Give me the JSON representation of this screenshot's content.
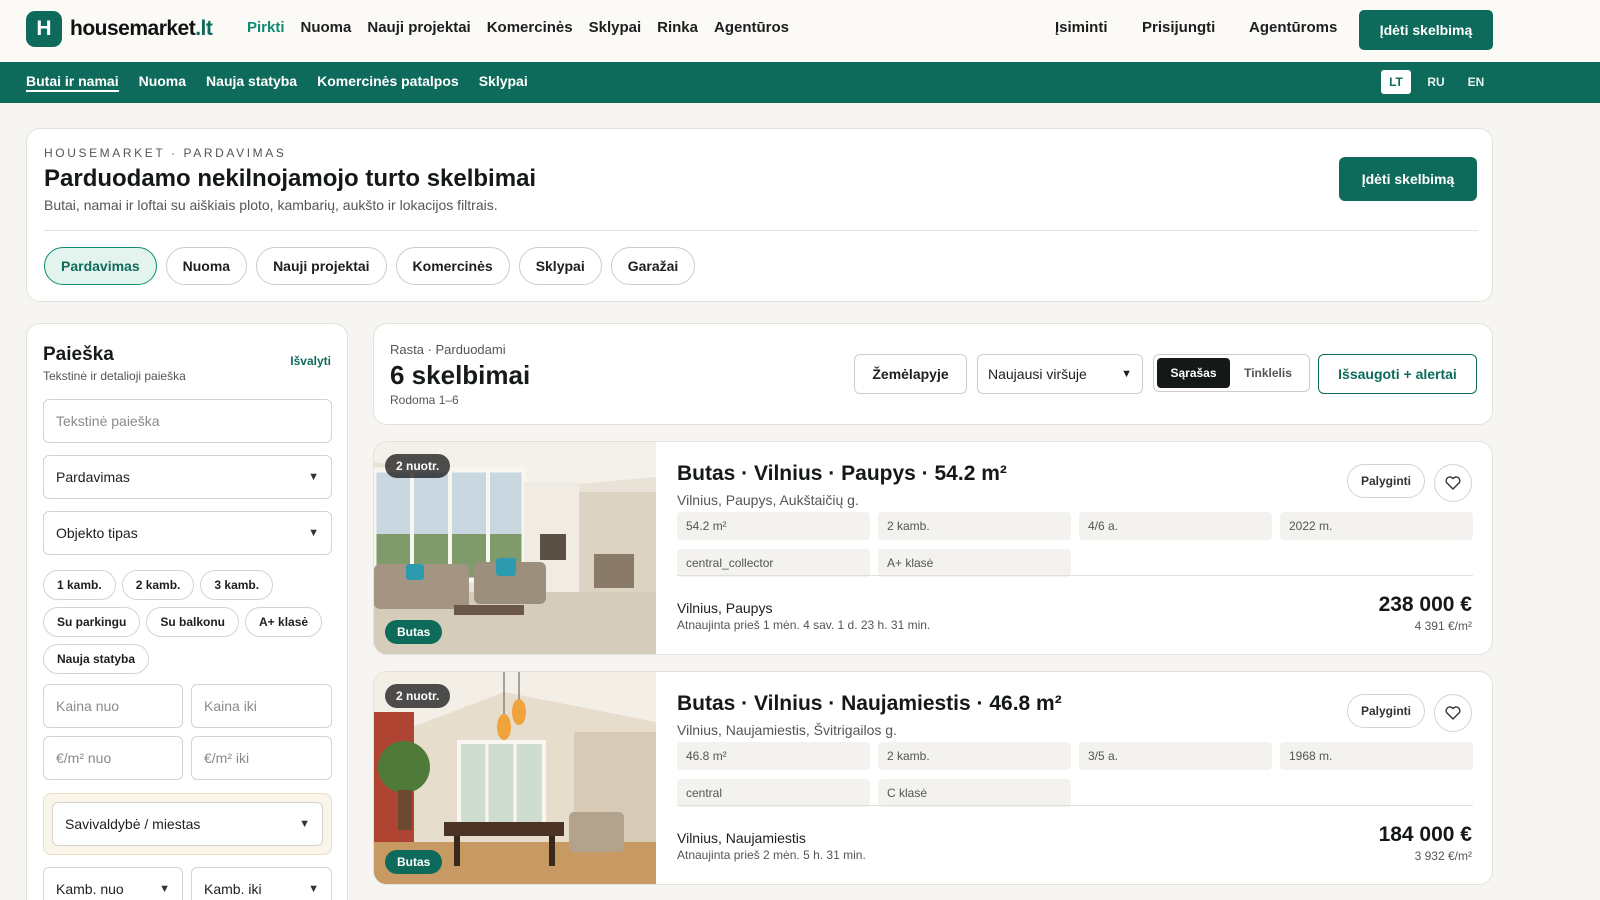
{
  "brand": {
    "mark": "H",
    "name": "housemarket",
    "tld": ".lt"
  },
  "main_nav": [
    "Pirkti",
    "Nuoma",
    "Nauji projektai",
    "Komercinės",
    "Sklypai",
    "Rinka",
    "Agentūros"
  ],
  "top_links": {
    "saved": "Įsiminti",
    "login": "Prisijungti",
    "agencies": "Agentūroms",
    "post_ad": "Įdėti skelbimą"
  },
  "sub_nav": [
    "Butai ir namai",
    "Nuoma",
    "Nauja statyba",
    "Komercinės patalpos",
    "Sklypai"
  ],
  "languages": [
    "LT",
    "RU",
    "EN"
  ],
  "hero": {
    "kicker": "HOUSEMARKET · PARDAVIMAS",
    "title": "Parduodamo nekilnojamojo turto skelbimai",
    "subtitle": "Butai, namai ir loftai su aiškiais ploto, kambarių, aukšto ir lokacijos filtrais.",
    "button": "Įdėti skelbimą",
    "pills": [
      "Pardavimas",
      "Nuoma",
      "Nauji projektai",
      "Komercinės",
      "Sklypai",
      "Garažai"
    ]
  },
  "sidebar": {
    "title": "Paieška",
    "subtitle": "Tekstinė ir detalioji paieška",
    "clear": "Išvalyti",
    "text_search_placeholder": "Tekstinė paieška",
    "deal_type": "Pardavimas",
    "object_type": "Objekto tipas",
    "chips": [
      "1 kamb.",
      "2 kamb.",
      "3 kamb.",
      "Su parkingu",
      "Su balkonu",
      "A+ klasė",
      "Nauja statyba"
    ],
    "price_from": "Kaina nuo",
    "price_to": "Kaina iki",
    "ppm_from": "€/m² nuo",
    "ppm_to": "€/m² iki",
    "municipality": "Savivaldybė / miestas",
    "rooms_from": "Kamb. nuo",
    "rooms_to": "Kamb. iki"
  },
  "results": {
    "kicker": "Rasta · Parduodami",
    "count": "6 skelbimai",
    "range": "Rodoma 1–6",
    "map_button": "Žemėlapyje",
    "sort": "Naujausi viršuje",
    "view_list": "Sąrašas",
    "view_grid": "Tinklelis",
    "save_alert": "Išsaugoti + alertai"
  },
  "listings": [
    {
      "photos_badge": "2 nuotr.",
      "type_badge": "Butas",
      "title": "Butas · Vilnius · Paupys · 54.2 m²",
      "address": "Vilnius, Paupys, Aukštaičių g.",
      "facts": [
        "54.2 m²",
        "2 kamb.",
        "4/6 a.",
        "2022 m.",
        "central_collector",
        "A+ klasė"
      ],
      "compare": "Palyginti",
      "location": "Vilnius, Paupys",
      "updated": "Atnaujinta prieš 1 mėn. 4 sav. 1 d. 23 h. 31 min.",
      "price": "238 000 €",
      "price_per_m2": "4 391 €/m²"
    },
    {
      "photos_badge": "2 nuotr.",
      "type_badge": "Butas",
      "title": "Butas · Vilnius · Naujamiestis · 46.8 m²",
      "address": "Vilnius, Naujamiestis, Švitrigailos g.",
      "facts": [
        "46.8 m²",
        "2 kamb.",
        "3/5 a.",
        "1968 m.",
        "central",
        "C klasė"
      ],
      "compare": "Palyginti",
      "location": "Vilnius, Naujamiestis",
      "updated": "Atnaujinta prieš 2 mėn. 5 h. 31 min.",
      "price": "184 000 €",
      "price_per_m2": "3 932 €/m²"
    }
  ]
}
